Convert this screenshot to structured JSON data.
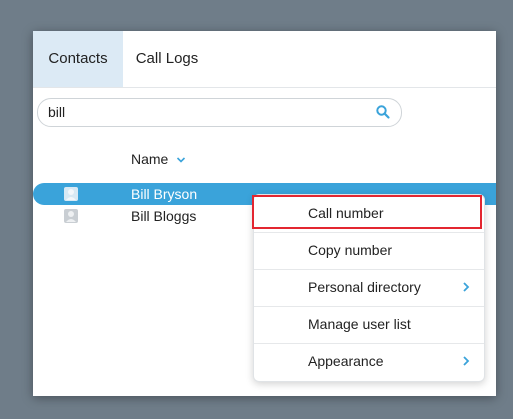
{
  "tabs": [
    {
      "label": "Contacts",
      "active": true
    },
    {
      "label": "Call Logs",
      "active": false
    }
  ],
  "search": {
    "value": "bill",
    "icon": "search-icon"
  },
  "table": {
    "name_header": "Name",
    "sort_icon": "chevron-down-icon",
    "rows": [
      {
        "name": "Bill Bryson",
        "selected": true
      },
      {
        "name": "Bill Bloggs",
        "selected": false
      }
    ]
  },
  "context_menu": {
    "items": [
      {
        "label": "Call number",
        "has_submenu": false,
        "highlighted": true
      },
      {
        "label": "Copy number",
        "has_submenu": false
      },
      {
        "label": "Personal directory",
        "has_submenu": true
      },
      {
        "label": "Manage user list",
        "has_submenu": false
      },
      {
        "label": "Appearance",
        "has_submenu": true
      }
    ]
  },
  "colors": {
    "accent": "#3aa3da",
    "active_tab": "#dceaf5",
    "highlight_border": "#e32630",
    "background": "#6f7d89"
  }
}
